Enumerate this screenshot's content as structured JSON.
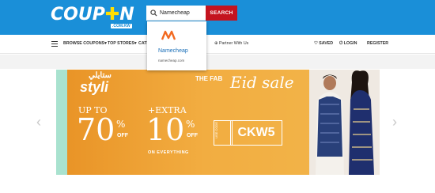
{
  "header": {
    "logo_text": "COUP",
    "logo_text_end": "N",
    "logo_domain": ".COM.KW"
  },
  "search": {
    "value": "Namecheap",
    "button_label": "SEARCH"
  },
  "dropdown": {
    "result_name": "Namecheap",
    "result_url": "namecheap.com"
  },
  "nav": {
    "items": [
      {
        "label": "BROWSE COUPONS▾"
      },
      {
        "label": "TOP STORES▾"
      },
      {
        "label": "CATE"
      },
      {
        "label": "Partner With Us"
      }
    ],
    "right": {
      "saved": "SAVED",
      "login": "LOGIN",
      "register": "REGISTER"
    }
  },
  "banner": {
    "brand_ar": "ستايلي",
    "brand": "styli",
    "headline_small": "THE FAB",
    "headline_script": "Eid sale",
    "upto": "UP TO",
    "discount1": "70",
    "pct": "%",
    "off": "OFF",
    "extra": "+EXTRA",
    "discount2": "10",
    "everything": "ON EVERYTHING",
    "use_code": "USE CODE",
    "code": "CKW5"
  },
  "colors": {
    "header_blue": "#1a8fd8",
    "search_red": "#c4141f",
    "banner_orange": "#f1a537",
    "banner_mint": "#a9e2cf"
  }
}
